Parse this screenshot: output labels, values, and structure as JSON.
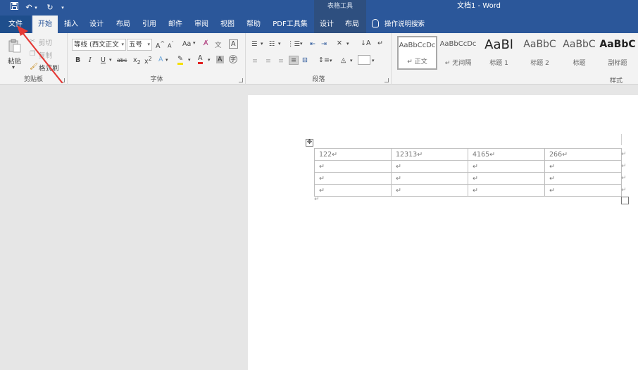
{
  "titlebar": {
    "context_group": "表格工具",
    "doc_title": "文档1  -  Word"
  },
  "tabs": [
    {
      "label": "文件"
    },
    {
      "label": "开始"
    },
    {
      "label": "插入"
    },
    {
      "label": "设计"
    },
    {
      "label": "布局"
    },
    {
      "label": "引用"
    },
    {
      "label": "邮件"
    },
    {
      "label": "审阅"
    },
    {
      "label": "视图"
    },
    {
      "label": "帮助"
    },
    {
      "label": "PDF工具集"
    },
    {
      "label": "设计"
    },
    {
      "label": "布局"
    }
  ],
  "tell_me": "操作说明搜索",
  "ribbon": {
    "clipboard": {
      "label": "剪贴板",
      "paste": "粘贴",
      "cut": "剪切",
      "copy": "复制",
      "format_painter": "格式刷"
    },
    "font": {
      "label": "字体",
      "font_name": "等线 (西文正文",
      "font_size": "五号",
      "change_case": "Aa"
    },
    "paragraph": {
      "label": "段落"
    },
    "styles": {
      "label": "样式",
      "items": [
        {
          "sample": "AaBbCcDc",
          "name": "↵ 正文"
        },
        {
          "sample": "AaBbCcDc",
          "name": "↵ 无间隔"
        },
        {
          "sample": "AaBl",
          "name": "标题 1"
        },
        {
          "sample": "AaBbC",
          "name": "标题 2"
        },
        {
          "sample": "AaBbC",
          "name": "标题"
        },
        {
          "sample": "AaBbC",
          "name": "副标题"
        }
      ]
    }
  },
  "table": {
    "rows": [
      [
        "122↵",
        "12313↵",
        "4165↵",
        "266↵"
      ],
      [
        "↵",
        "↵",
        "↵",
        "↵"
      ],
      [
        "↵",
        "↵",
        "↵",
        "↵"
      ],
      [
        "↵",
        "↵",
        "↵",
        "↵"
      ]
    ],
    "row_end_mark": "↵",
    "paragraph_mark": "↵"
  },
  "colors": {
    "title_bar": "#2b579a",
    "ribbon_bg": "#f3f3f3",
    "annotation_arrow": "#e53935"
  }
}
